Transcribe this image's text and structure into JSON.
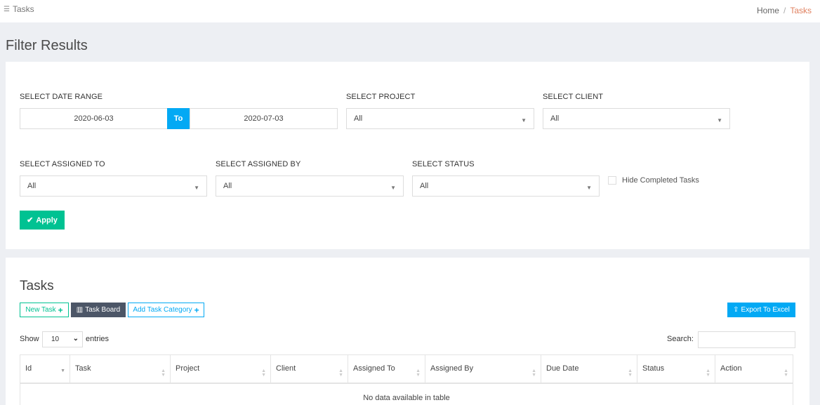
{
  "header": {
    "title": "Tasks",
    "breadcrumb": {
      "home": "Home",
      "separator": "/",
      "current": "Tasks"
    }
  },
  "filters": {
    "heading": "Filter Results",
    "date_range": {
      "label": "SELECT DATE RANGE",
      "start": "2020-06-03",
      "to_label": "To",
      "end": "2020-07-03"
    },
    "project": {
      "label": "SELECT PROJECT",
      "value": "All"
    },
    "client": {
      "label": "SELECT CLIENT",
      "value": "All"
    },
    "assigned_to": {
      "label": "SELECT ASSIGNED TO",
      "value": "All"
    },
    "assigned_by": {
      "label": "SELECT ASSIGNED BY",
      "value": "All"
    },
    "status": {
      "label": "SELECT STATUS",
      "value": "All"
    },
    "hide_completed_label": "Hide Completed Tasks",
    "apply_label": "Apply"
  },
  "tasks": {
    "heading": "Tasks",
    "buttons": {
      "new_task": "New Task",
      "task_board": "Task Board",
      "add_category": "Add Task Category",
      "export": "Export To Excel"
    },
    "length": {
      "show": "Show",
      "value": "10",
      "entries": "entries"
    },
    "search_label": "Search:",
    "columns": [
      "Id",
      "Task",
      "Project",
      "Client",
      "Assigned To",
      "Assigned By",
      "Due Date",
      "Status",
      "Action"
    ],
    "empty_message": "No data available in table"
  },
  "colors": {
    "primary": "#03a9f4",
    "success": "#00c292",
    "dark": "#4c5667",
    "breadcrumb_active": "#e0805f"
  }
}
